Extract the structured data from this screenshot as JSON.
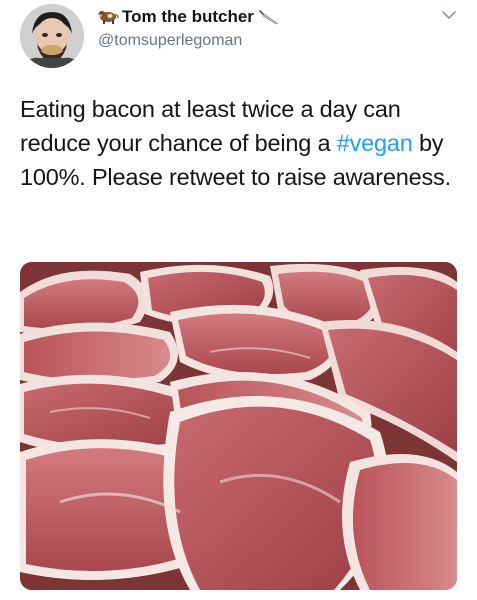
{
  "tweet": {
    "display_name": "Tom the butcher",
    "handle": "@tomsuperlegoman",
    "text_before": "Eating bacon at least twice a day can reduce your chance of being a ",
    "hashtag": "#vegan",
    "text_after": " by 100%. Please retweet to raise awareness.",
    "name_emoji_icon": "cow-icon",
    "name_trailing_icon": "knife-icon",
    "menu_icon": "chevron-down-icon",
    "media_description_icon": "photo"
  },
  "colors": {
    "text": "#14171a",
    "secondary": "#657786",
    "link": "#1da1f2",
    "meat": "#b5525a",
    "fat": "#f1e4e2"
  }
}
